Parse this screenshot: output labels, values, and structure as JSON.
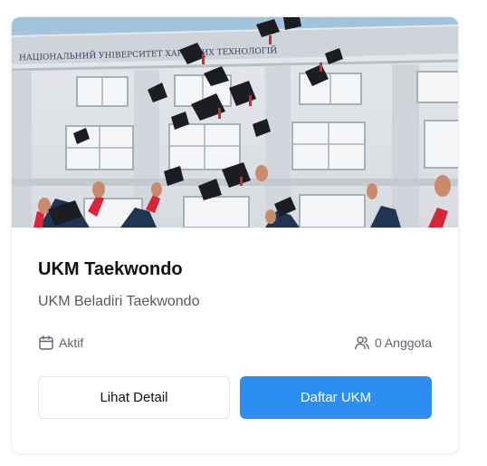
{
  "card": {
    "image_alt": "Wisuda — topi toga dilempar di depan gedung",
    "banner_text": "НАЦІОНАЛЬНИЙ УНІВЕРСИТЕТ ХАРЧОВИХ ТЕХНОЛОГІЙ",
    "title": "UKM Taekwondo",
    "description": "UKM Beladiri Taekwondo",
    "status": {
      "icon": "calendar-icon",
      "label": "Aktif"
    },
    "members": {
      "icon": "users-icon",
      "label": "0 Anggota"
    },
    "detail_button": "Lihat Detail",
    "join_button": "Daftar UKM"
  },
  "colors": {
    "primary": "#2b8ef0",
    "title": "#111111",
    "muted": "#5f6670"
  }
}
